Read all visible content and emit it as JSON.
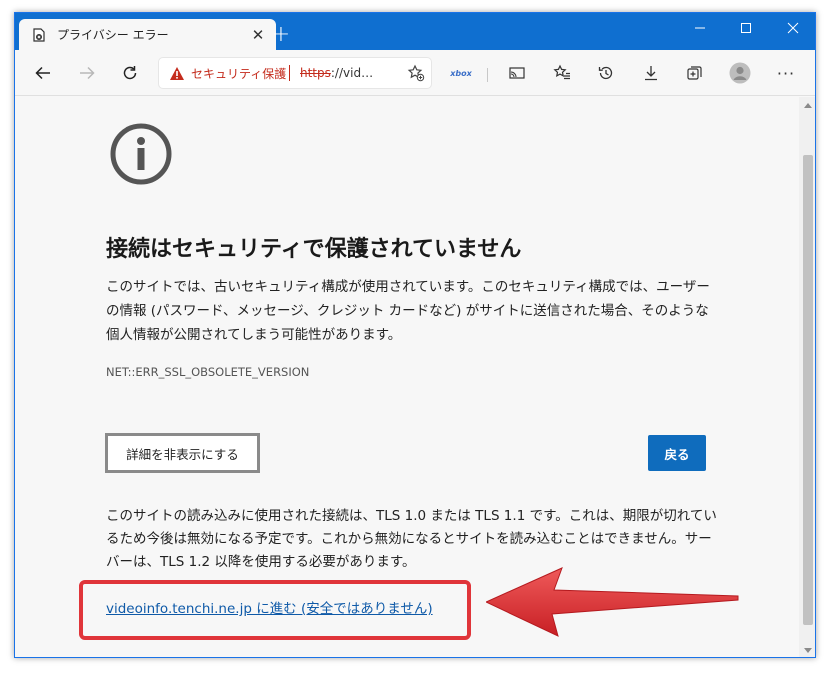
{
  "tab": {
    "title": "プライバシー エラー",
    "favicon": "error-page-icon"
  },
  "window_controls": {
    "minimize": "minimize-icon",
    "maximize": "maximize-icon",
    "close": "close-icon"
  },
  "toolbar": {
    "security_warning": "セキュリティ保護なし",
    "url_scheme": "https",
    "url_rest": "://vid…",
    "extension_label": "xbox"
  },
  "content": {
    "heading": "接続はセキュリティで保護されていません",
    "description": "このサイトでは、古いセキュリティ構成が使用されています。このセキュリティ構成では、ユーザーの情報 (パスワード、メッセージ、クレジット カードなど) がサイトに送信された場合、そのような個人情報が公開されてしまう可能性があります。",
    "error_code": "NET::ERR_SSL_OBSOLETE_VERSION",
    "details_button": "詳細を非表示にする",
    "back_button": "戻る",
    "details_text": "このサイトの読み込みに使用された接続は、TLS 1.0 または TLS 1.1 です。これは、期限が切れているため今後は無効になる予定です。これから無効になるとサイトを読み込むことはできません。サーバーは、TLS 1.2 以降を使用する必要があります。",
    "proceed_link": "videoinfo.tenchi.ne.jp に進む (安全ではありません)"
  },
  "colors": {
    "titlebar": "#0f6fd0",
    "warning": "#c42b1c",
    "primary_button": "#0f6cbd",
    "link": "#0f5aa8",
    "annotation": "#e0353a"
  }
}
